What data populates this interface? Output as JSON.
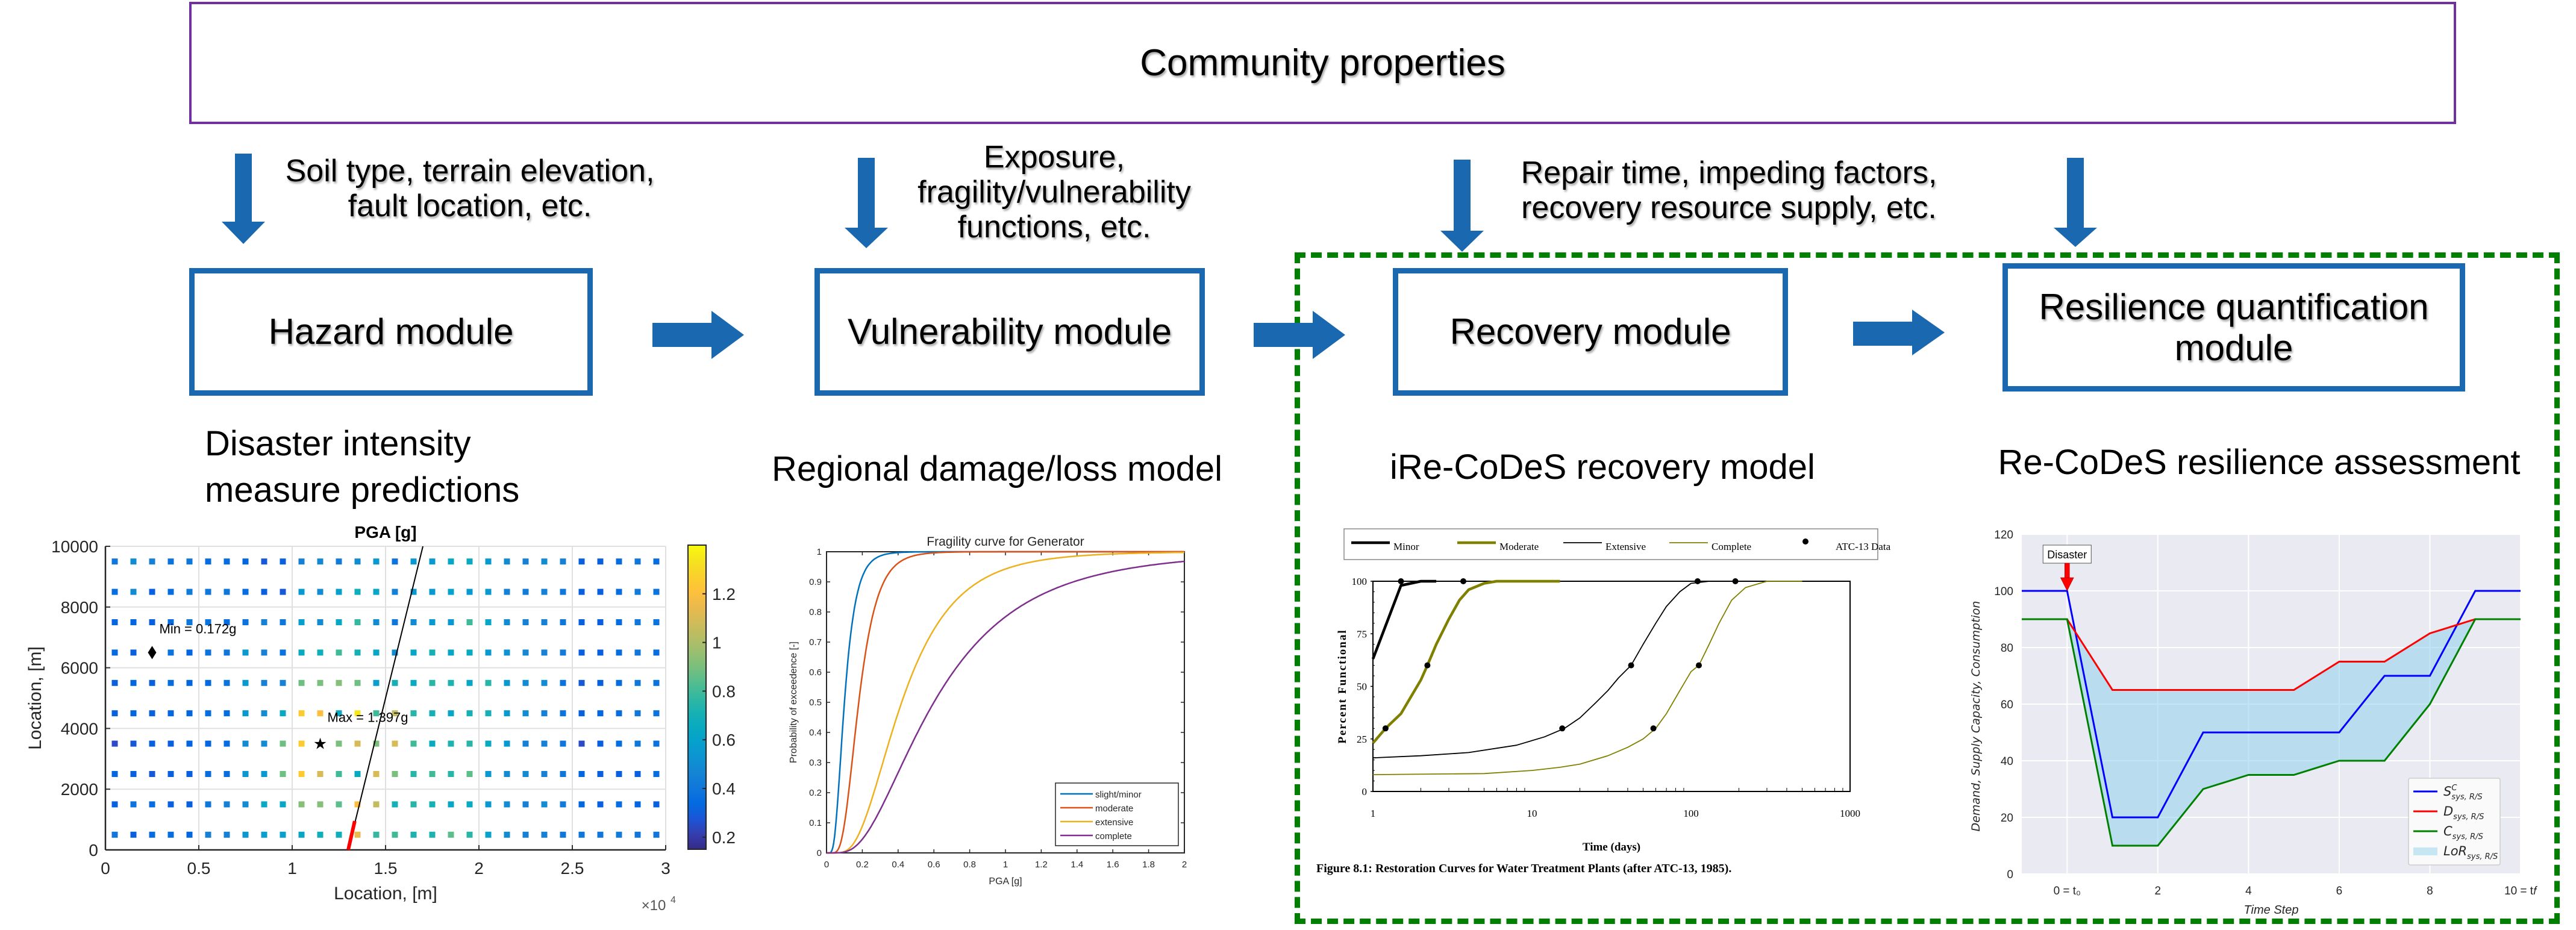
{
  "community": {
    "label": "Community properties"
  },
  "inputs": [
    {
      "lines": [
        "Soil type, terrain elevation,",
        "fault location, etc."
      ]
    },
    {
      "lines": [
        "Exposure,",
        "fragility/vulnerability",
        "functions, etc."
      ]
    },
    {
      "lines": [
        "Repair time, impeding factors,",
        "recovery resource supply, etc."
      ]
    },
    {
      "lines": []
    }
  ],
  "modules": [
    {
      "lines": [
        "Hazard module"
      ]
    },
    {
      "lines": [
        "Vulnerability module"
      ]
    },
    {
      "lines": [
        "Recovery module"
      ]
    },
    {
      "lines": [
        "Resilience quantification",
        "module"
      ]
    }
  ],
  "section_titles": [
    {
      "lines": [
        "Disaster intensity",
        "measure predictions"
      ]
    },
    {
      "lines": [
        "Regional damage/loss model"
      ]
    },
    {
      "lines": [
        "iRe-CoDeS recovery model"
      ]
    },
    {
      "lines": [
        "Re-CoDeS resilience assessment"
      ]
    }
  ],
  "colors": {
    "community_border": "#7030a0",
    "module_blue": "#1a69b0",
    "dashed_green": "#007f00"
  },
  "chart_data": [
    {
      "id": "hazard",
      "type": "heatmap",
      "title": "PGA [g]",
      "xlabel": "Location, [m]",
      "ylabel": "Location, [m]",
      "x_exponent_label": "×10^4",
      "xlim": [
        0,
        30000
      ],
      "ylim": [
        0,
        10000
      ],
      "xticks": [
        0,
        0.5,
        1,
        1.5,
        2,
        2.5,
        3
      ],
      "yticks": [
        0,
        2000,
        4000,
        6000,
        8000,
        10000
      ],
      "grid": true,
      "colorbar": {
        "min": 0.15,
        "max": 1.4,
        "ticks": [
          0.2,
          0.4,
          0.6,
          0.8,
          1,
          1.2
        ]
      },
      "grid_x": [
        500,
        1500,
        2500,
        3500,
        4500,
        5500,
        6500,
        7500,
        8500,
        9500,
        10500,
        11500,
        12500,
        13500,
        14500,
        15500,
        16500,
        17500,
        18500,
        19500,
        20500,
        21500,
        22500,
        23500,
        24500,
        25500,
        26500,
        27500,
        28500,
        29500
      ],
      "grid_y": [
        9500,
        8500,
        7500,
        6500,
        5500,
        4500,
        3500,
        2500,
        1500,
        500
      ],
      "pga": [
        [
          0.4,
          0.5,
          0.45,
          0.38,
          0.4,
          0.35,
          0.35,
          0.32,
          0.28,
          0.3,
          0.45,
          0.48,
          0.42,
          0.5,
          0.55,
          0.38,
          0.55,
          0.55,
          0.62,
          0.65,
          0.55,
          0.5,
          0.45,
          0.5,
          0.45,
          0.3,
          0.3,
          0.35,
          0.4,
          0.35
        ],
        [
          0.35,
          0.5,
          0.3,
          0.35,
          0.42,
          0.4,
          0.4,
          0.35,
          0.3,
          0.28,
          0.55,
          0.5,
          0.58,
          0.68,
          0.62,
          0.45,
          0.55,
          0.55,
          0.6,
          0.55,
          0.55,
          0.45,
          0.42,
          0.45,
          0.4,
          0.3,
          0.3,
          0.35,
          0.42,
          0.38
        ],
        [
          0.32,
          0.32,
          0.3,
          0.35,
          0.4,
          0.38,
          0.35,
          0.38,
          0.45,
          0.4,
          0.58,
          0.5,
          0.62,
          0.78,
          0.5,
          0.4,
          0.5,
          0.55,
          0.55,
          0.8,
          0.62,
          0.5,
          0.45,
          0.45,
          0.4,
          0.3,
          0.3,
          0.35,
          0.4,
          0.38
        ],
        [
          0.33,
          0.3,
          0.172,
          0.38,
          0.32,
          0.38,
          0.4,
          0.55,
          0.45,
          0.38,
          0.65,
          0.68,
          0.8,
          0.7,
          0.62,
          0.5,
          0.62,
          0.7,
          0.62,
          0.65,
          0.55,
          0.52,
          0.48,
          0.45,
          0.42,
          0.3,
          0.3,
          0.35,
          0.4,
          0.35
        ],
        [
          0.3,
          0.32,
          0.3,
          0.35,
          0.32,
          0.33,
          0.38,
          0.55,
          0.45,
          0.45,
          0.88,
          0.9,
          0.92,
          0.88,
          0.58,
          0.7,
          0.65,
          0.75,
          0.72,
          0.62,
          0.75,
          0.55,
          0.5,
          0.5,
          0.38,
          0.28,
          0.3,
          0.35,
          0.4,
          0.38
        ],
        [
          0.3,
          0.32,
          0.3,
          0.32,
          0.32,
          0.35,
          0.35,
          0.55,
          0.5,
          0.65,
          1.25,
          1.2,
          0.65,
          1.35,
          0.8,
          1.05,
          0.75,
          0.7,
          0.62,
          0.7,
          0.7,
          0.55,
          0.5,
          0.45,
          0.38,
          0.3,
          0.32,
          0.35,
          0.4,
          0.38
        ],
        [
          0.25,
          0.28,
          0.3,
          0.3,
          0.32,
          0.32,
          0.35,
          0.5,
          0.5,
          0.88,
          1.25,
          1.397,
          0.9,
          1.1,
          0.9,
          1.1,
          0.8,
          0.65,
          0.72,
          0.75,
          0.65,
          0.55,
          0.45,
          0.45,
          0.4,
          0.25,
          0.3,
          0.35,
          0.4,
          0.38
        ],
        [
          0.32,
          0.3,
          0.28,
          0.3,
          0.3,
          0.35,
          0.35,
          0.55,
          0.55,
          0.88,
          1.25,
          1.1,
          0.8,
          0.65,
          1.1,
          0.9,
          0.75,
          0.8,
          0.75,
          0.85,
          0.55,
          0.5,
          0.5,
          0.45,
          0.4,
          0.32,
          0.3,
          0.3,
          0.3,
          0.35
        ],
        [
          0.3,
          0.38,
          0.35,
          0.3,
          0.3,
          0.4,
          0.45,
          0.5,
          0.65,
          0.62,
          0.92,
          0.92,
          0.85,
          1.2,
          1.05,
          0.7,
          0.75,
          0.7,
          0.62,
          0.65,
          0.55,
          0.5,
          0.45,
          0.5,
          0.42,
          0.32,
          0.3,
          0.35,
          0.32,
          0.3
        ],
        [
          0.4,
          0.3,
          0.35,
          0.35,
          0.32,
          0.45,
          0.45,
          0.55,
          0.58,
          0.58,
          0.62,
          0.68,
          0.68,
          1.15,
          0.78,
          0.8,
          0.72,
          0.72,
          0.85,
          0.75,
          0.6,
          0.5,
          0.45,
          0.45,
          0.4,
          0.4,
          0.4,
          0.42,
          0.4,
          0.4
        ]
      ],
      "annotations": [
        {
          "text": "Min = 0.172g",
          "x": 2500,
          "y": 6500,
          "marker": "diamond"
        },
        {
          "text": "Max = 1.397g",
          "x": 11500,
          "y": 3500,
          "marker": "star"
        }
      ],
      "fault_line": {
        "x": [
          13000,
          17000
        ],
        "y": [
          0,
          10000
        ],
        "rupture_x": [
          13000,
          13350
        ],
        "rupture_y": [
          0,
          950
        ]
      }
    },
    {
      "id": "fragility",
      "type": "line",
      "title": "Fragility curve for Generator",
      "xlabel": "PGA [g]",
      "ylabel": "Probability of exceedence [-]",
      "xlim": [
        0,
        2
      ],
      "ylim": [
        0,
        1
      ],
      "xticks": [
        0,
        0.2,
        0.4,
        0.6,
        0.8,
        1,
        1.2,
        1.4,
        1.6,
        1.8,
        2
      ],
      "yticks": [
        0,
        0.1,
        0.2,
        0.3,
        0.4,
        0.5,
        0.6,
        0.7,
        0.8,
        0.9,
        1
      ],
      "legend_position": "bottom-right",
      "series": [
        {
          "name": "slight/minor",
          "color": "#0072bd",
          "median": 0.1,
          "beta": 0.5
        },
        {
          "name": "moderate",
          "color": "#d95319",
          "median": 0.18,
          "beta": 0.45
        },
        {
          "name": "extensive",
          "color": "#edb120",
          "median": 0.42,
          "beta": 0.55
        },
        {
          "name": "complete",
          "color": "#7e2f8e",
          "median": 0.6,
          "beta": 0.65
        }
      ]
    },
    {
      "id": "recovery",
      "type": "line",
      "title": "",
      "caption": "Figure 8.1:  Restoration Curves for Water Treatment Plants (after ATC-13, 1985).",
      "xlabel": "Time (days)",
      "ylabel": "Percent Functional",
      "xscale": "log",
      "xlim": [
        1,
        1000
      ],
      "ylim": [
        0,
        100
      ],
      "xticks": [
        1,
        10,
        100,
        1000
      ],
      "yticks": [
        0,
        25,
        50,
        75,
        100
      ],
      "legend_position": "top",
      "series": [
        {
          "name": "Minor",
          "color": "#000000",
          "weight": "thick",
          "x": [
            1,
            1.5,
            2,
            2.5
          ],
          "y": [
            63,
            98,
            100,
            100
          ]
        },
        {
          "name": "Moderate",
          "color": "#808000",
          "weight": "thick",
          "x": [
            1,
            1.2,
            1.5,
            2,
            2.2,
            2.5,
            3,
            3.5,
            4,
            5,
            6,
            8,
            15
          ],
          "y": [
            23,
            30,
            37,
            53,
            60,
            70,
            82,
            91,
            96,
            99,
            100,
            100,
            100
          ]
        },
        {
          "name": "Extensive",
          "color": "#000000",
          "weight": "thin",
          "x": [
            1,
            2,
            4,
            8,
            12,
            16,
            20,
            25,
            30,
            35,
            42,
            50,
            60,
            70,
            85,
            100,
            130,
            200
          ],
          "y": [
            16,
            17,
            18.5,
            22,
            26,
            30,
            35,
            42,
            48,
            54,
            60,
            70,
            80,
            88,
            95,
            99,
            100,
            100
          ]
        },
        {
          "name": "Complete",
          "color": "#808000",
          "weight": "thin",
          "x": [
            1,
            5,
            10,
            15,
            20,
            30,
            40,
            50,
            60,
            70,
            85,
            100,
            112,
            130,
            150,
            180,
            220,
            300,
            500
          ],
          "y": [
            8,
            8.5,
            10,
            11.5,
            13,
            17,
            21,
            25,
            30,
            37,
            48,
            57,
            60,
            70,
            80,
            91,
            97,
            100,
            100
          ]
        }
      ],
      "atc13_points": {
        "name": "ATC-13 Data",
        "x": [
          1.5,
          3.7,
          1.2,
          2.2,
          15.5,
          42,
          110,
          58,
          112,
          190
        ],
        "y": [
          100,
          100,
          30,
          60,
          30,
          60,
          100,
          30,
          60,
          100
        ]
      }
    },
    {
      "id": "resilience",
      "type": "line",
      "title": "",
      "xlabel": "Time Step",
      "ylabel": "Demand,  Supply Capacity,  Consumption",
      "xlim": [
        -1,
        10
      ],
      "ylim": [
        0,
        120
      ],
      "xticks": [
        0,
        2,
        4,
        6,
        8,
        10
      ],
      "xtick_labels": [
        "0 = t0",
        "2",
        "4",
        "6",
        "8",
        "10 = tf"
      ],
      "yticks": [
        0,
        20,
        40,
        60,
        80,
        100,
        120
      ],
      "grid": true,
      "legend_position": "bottom-right",
      "annotation": {
        "text": "Disaster",
        "x": 0,
        "y": 100
      },
      "x": [
        -1,
        0,
        1,
        2,
        3,
        4,
        5,
        6,
        7,
        8,
        9,
        10
      ],
      "series": [
        {
          "name": "S^C_sys,R/S",
          "color": "#0000ff",
          "values": [
            100,
            100,
            20,
            20,
            50,
            50,
            50,
            50,
            70,
            70,
            100,
            100
          ]
        },
        {
          "name": "D_sys,R/S",
          "color": "#ff0000",
          "values": [
            90,
            90,
            65,
            65,
            65,
            65,
            65,
            75,
            75,
            85,
            90,
            90
          ]
        },
        {
          "name": "C_sys,R/S",
          "color": "#008000",
          "values": [
            90,
            90,
            10,
            10,
            30,
            35,
            35,
            40,
            40,
            60,
            90,
            90
          ]
        }
      ],
      "fill": {
        "name": "LoR_sys,R/S",
        "color": "#87ceeb",
        "between": [
          "D_sys,R/S",
          "C_sys,R/S"
        ]
      },
      "legend": [
        {
          "main": "S",
          "sup": "C",
          "sub": "sys, R/S"
        },
        {
          "main": "D",
          "sup": "",
          "sub": "sys, R/S"
        },
        {
          "main": "C",
          "sup": "",
          "sub": "sys, R/S"
        },
        {
          "main": "LoR",
          "sup": "",
          "sub": "sys, R/S"
        }
      ]
    }
  ]
}
